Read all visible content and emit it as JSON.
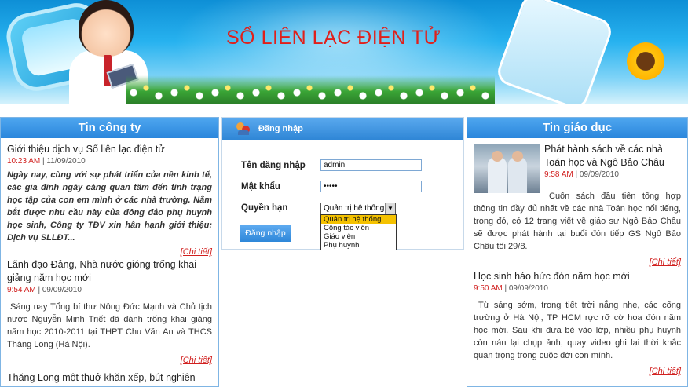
{
  "banner": {
    "title": "SỔ LIÊN LẠC ĐIỆN TỬ"
  },
  "left": {
    "title": "Tin công ty",
    "more_label": "[Chi tiết]",
    "items": [
      {
        "title": "Giới thiệu dịch vụ Sổ liên lạc điện tử",
        "time": "10:23 AM",
        "date": "11/09/2010",
        "body": "Ngày nay, cùng với sự phát triển của nền kinh tế, các gia đình ngày càng quan tâm đến tình trạng học tập của con em mình ở các nhà trường. Nắm bắt được nhu cầu này của đông đảo phụ huynh học sinh, Công ty TĐV xin hân hạnh giới thiệu: Dịch vụ SLLĐT..."
      },
      {
        "title": "Lãnh đạo Đảng, Nhà nước gióng trống khai giảng năm học mới",
        "time": "9:54 AM",
        "date": "09/09/2010",
        "body": "Sáng nay Tổng bí thư Nông Đức Mạnh và Chủ tịch nước Nguyễn Minh Triết đã đánh trống khai giảng năm học 2010-2011 tại THPT Chu Văn An và THCS Thăng Long (Hà Nội)."
      },
      {
        "title": "Thăng Long một thuở khăn xếp, bút nghiên"
      }
    ]
  },
  "login": {
    "title": "Đăng nhập",
    "username_label": "Tên đăng nhập",
    "username_value": "admin",
    "password_label": "Mật khẩu",
    "password_value": "•••••",
    "role_label": "Quyền hạn",
    "role_selected": "Quản trị hệ thống",
    "role_options": [
      "Quản trị hệ thống",
      "Cộng tác viên",
      "Giáo viên",
      "Phụ huynh"
    ],
    "submit_label": "Đăng nhập"
  },
  "right": {
    "title": "Tin giáo dục",
    "more_label": "[Chi tiết]",
    "items": [
      {
        "title": "Phát hành sách về các nhà Toán học và Ngô Bảo Châu",
        "time": "9:58 AM",
        "date": "09/09/2010",
        "body": "Cuốn sách đầu tiên tổng hợp thông tin đầy đủ nhất về các nhà Toán học nổi tiếng, trong đó, có 12 trang viết về giáo sư Ngô Bảo Châu sẽ được phát hành tại buổi đón tiếp GS Ngô Bảo Châu tối 29/8."
      },
      {
        "title": "Học sinh háo hức đón năm học mới",
        "time": "9:50 AM",
        "date": "09/09/2010",
        "body": "Từ sáng sớm, trong tiết trời nắng nhẹ, các cổng trường ở Hà Nội, TP HCM rực rỡ cờ hoa đón năm học mới. Sau khi đưa bé vào lớp, nhiều phụ huynh còn nán lại chụp ảnh, quay video ghi lại thời khắc quan trọng trong cuộc đời con mình."
      }
    ]
  }
}
